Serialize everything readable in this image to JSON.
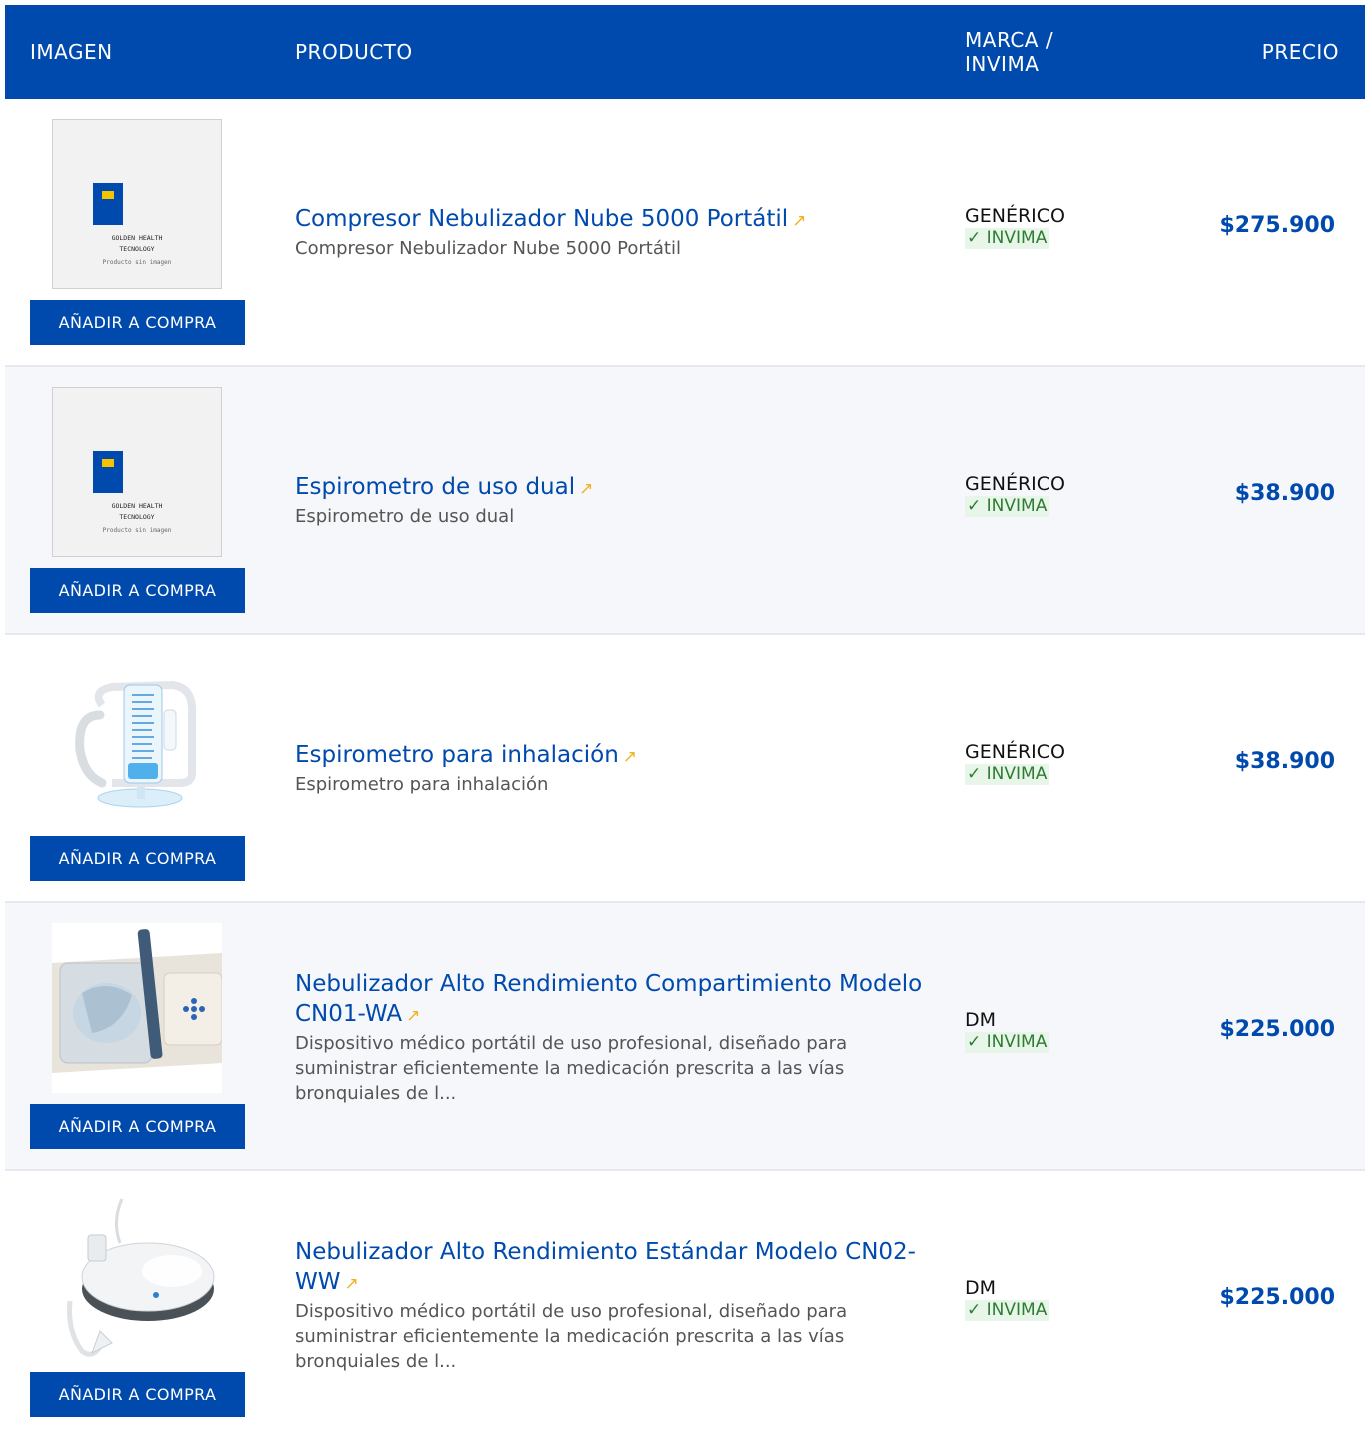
{
  "header": {
    "col_image": "IMAGEN",
    "col_product": "PRODUCTO",
    "col_brand": "MARCA / INVIMA",
    "col_price": "PRECIO"
  },
  "placeholder": {
    "title_line1": "GOLDEN HEALTH",
    "title_line2": "TECNOLOGY",
    "subtitle": "Producto sin imagen"
  },
  "colors": {
    "primary": "#004aad",
    "accent": "#f0b323",
    "invima_text": "#2e7d32",
    "invima_bg": "#e8f5e9"
  },
  "arrow_icon": "↗",
  "products": [
    {
      "title": "Compresor Nebulizador Nube 5000 Portátil",
      "description": "Compresor Nebulizador Nube 5000 Portátil",
      "brand": "GENÉRICO",
      "invima": "✓ INVIMA",
      "price": "$275.900",
      "button": "AÑADIR A COMPRA",
      "image": "placeholder"
    },
    {
      "title": "Espirometro de uso dual",
      "description": "Espirometro de uso dual",
      "brand": "GENÉRICO",
      "invima": "✓ INVIMA",
      "price": "$38.900",
      "button": "AÑADIR A COMPRA",
      "image": "placeholder"
    },
    {
      "title": "Espirometro para inhalación",
      "description": "Espirometro para inhalación",
      "brand": "GENÉRICO",
      "invima": "✓ INVIMA",
      "price": "$38.900",
      "button": "AÑADIR A COMPRA",
      "image": "spirometer-photo"
    },
    {
      "title": "Nebulizador Alto Rendimiento Compartimiento Modelo CN01-WA",
      "description": "Dispositivo médico portátil de uso profesional, diseñado para suministrar eficientemente la medicación prescrita a las vías bronquiales de l...",
      "brand": "DM",
      "invima": "✓ INVIMA",
      "price": "$225.000",
      "button": "AÑADIR A COMPRA",
      "image": "nebulizer-cn01-photo"
    },
    {
      "title": "Nebulizador Alto Rendimiento Estándar Modelo CN02-WW",
      "description": "Dispositivo médico portátil de uso profesional, diseñado para suministrar eficientemente la medicación prescrita a las vías bronquiales de l...",
      "brand": "DM",
      "invima": "✓ INVIMA",
      "price": "$225.000",
      "button": "AÑADIR A COMPRA",
      "image": "nebulizer-cn02-photo"
    }
  ]
}
